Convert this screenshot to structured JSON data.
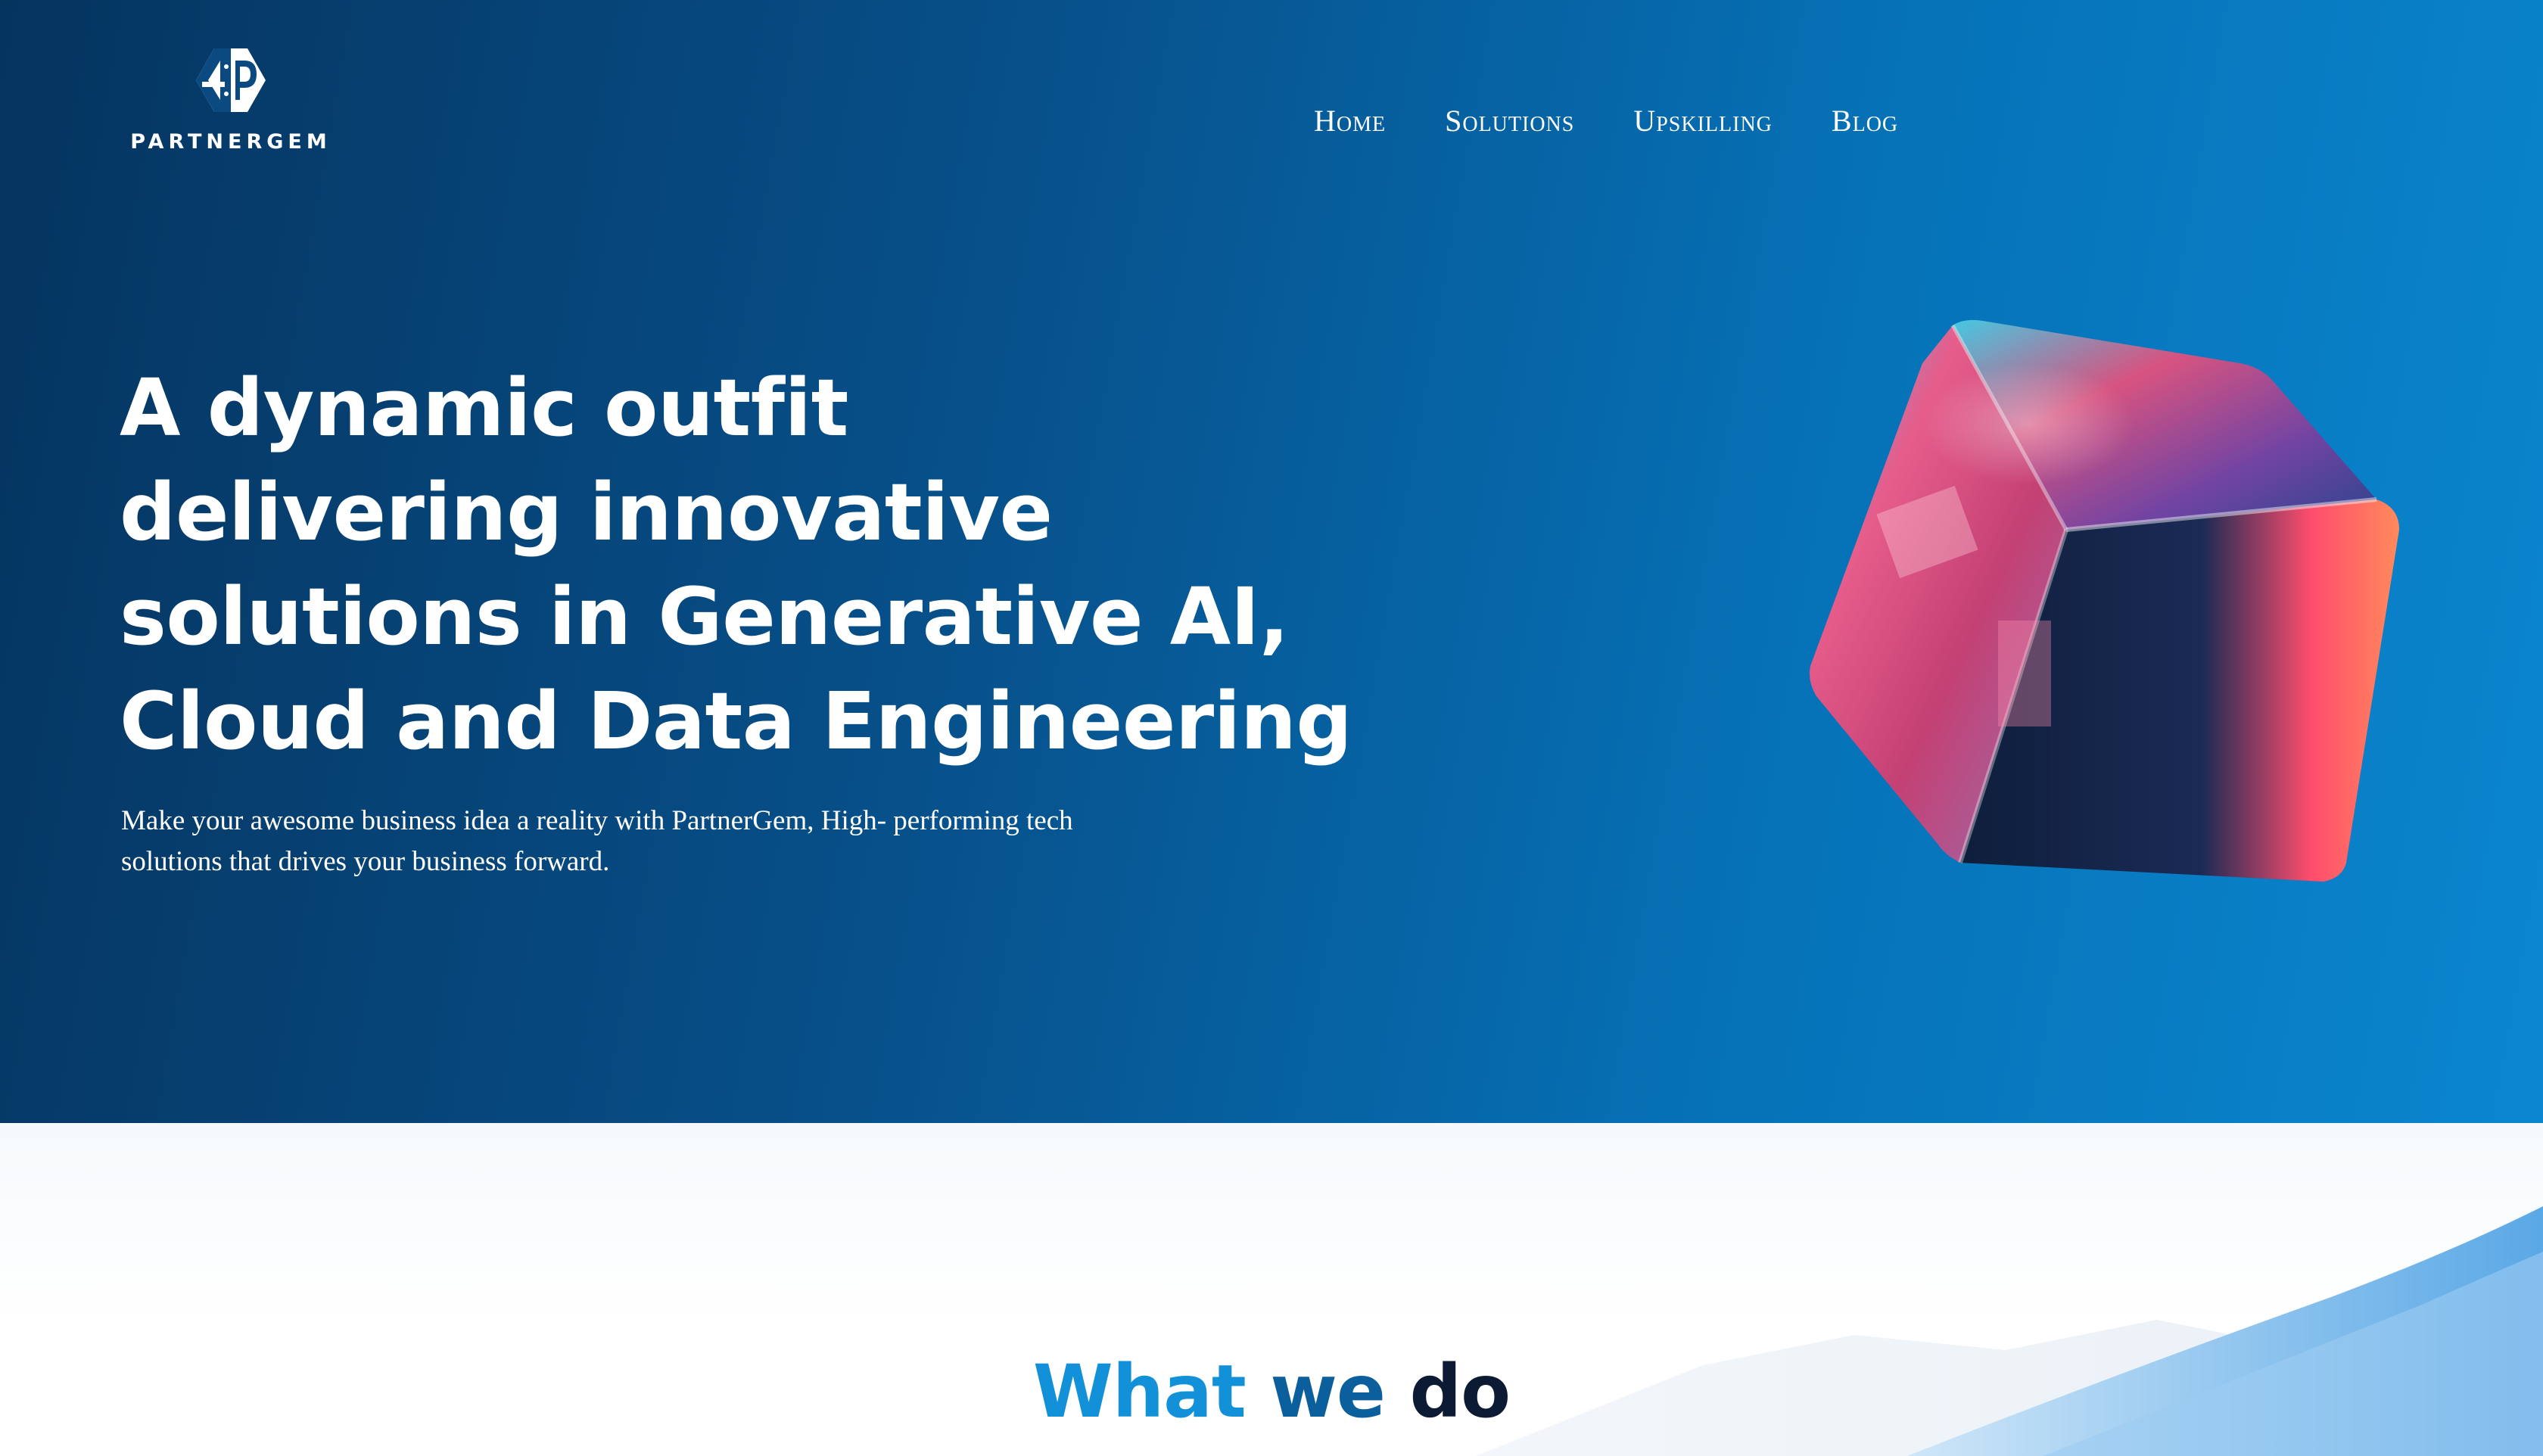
{
  "brand": {
    "name": "PARTNERGEM"
  },
  "nav": {
    "items": [
      {
        "label": "Home"
      },
      {
        "label": "Solutions"
      },
      {
        "label": "Upskilling"
      },
      {
        "label": "Blog"
      }
    ]
  },
  "hero": {
    "headline_lines": [
      "A dynamic outfit",
      "delivering innovative",
      "solutions in Generative AI,",
      "Cloud and Data Engineering"
    ],
    "subtext_lines": [
      "Make your awesome business idea a reality with PartnerGem, High- performing tech",
      "solutions that drives your business forward."
    ],
    "image": "glass-cube-image"
  },
  "section": {
    "title_part1": "What",
    "title_part2": "we",
    "title_part3": "do"
  },
  "colors": {
    "hero_dark": "#05345f",
    "hero_light": "#0a86cf",
    "accent_blue": "#1291d9",
    "mid_blue": "#0b5f9c",
    "title_dark": "#0c1b33"
  }
}
